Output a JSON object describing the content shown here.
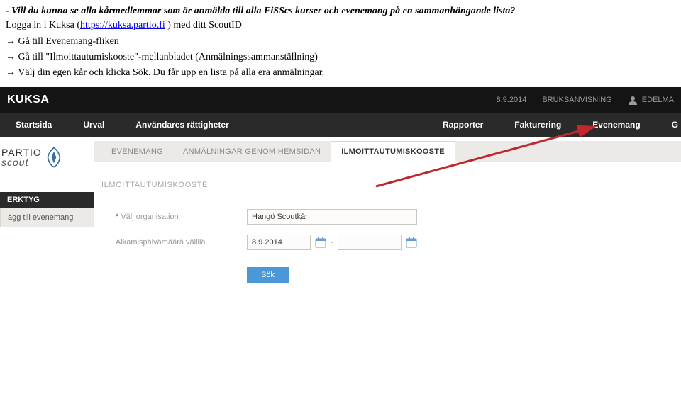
{
  "instructions": {
    "question": "- Vill du kunna se alla kårmedlemmar som är anmälda till alla FiSScs kurser och evenemang på en sammanhängande lista?",
    "login_prefix": "Logga in i Kuksa (",
    "login_link": "https://kuksa.partio.fi",
    "login_suffix": " ) med ditt ScoutID",
    "step1": "Gå till Evenemang-fliken",
    "step2": "Gå till \"Ilmoittautumiskooste\"-mellanbladet (Anmälningssammanställning)",
    "step3": "Välj din egen kår och klicka Sök. Du får upp en lista på alla era anmälningar."
  },
  "topbar": {
    "logo": "KUKSA",
    "date": "8.9.2014",
    "manual": "BRUKSANVISNING",
    "user": "EDELMA"
  },
  "mainnav": {
    "items": [
      "Startsida",
      "Urval",
      "Användares rättigheter",
      "Rapporter",
      "Fakturering",
      "Evenemang",
      "G"
    ]
  },
  "brand": {
    "line1": "PARTIO",
    "line2": "scout"
  },
  "subnav": {
    "items": [
      {
        "label": "EVENEMANG",
        "active": false
      },
      {
        "label": "ANMÄLNINGAR GENOM HEMSIDAN",
        "active": false
      },
      {
        "label": "ILMOITTAUTUMISKOOSTE",
        "active": true
      }
    ]
  },
  "breadcrumb": "ILMOITTAUTUMISKOOSTE",
  "sidebar": {
    "heading": "ERKTYG",
    "button": "ägg till evenemang"
  },
  "form": {
    "org_label": "Välj organisation",
    "org_value": "Hangö Scoutkår",
    "date_label": "Alkamispäivämäärä välillä",
    "date_value": "8.9.2014",
    "submit": "Sök"
  }
}
